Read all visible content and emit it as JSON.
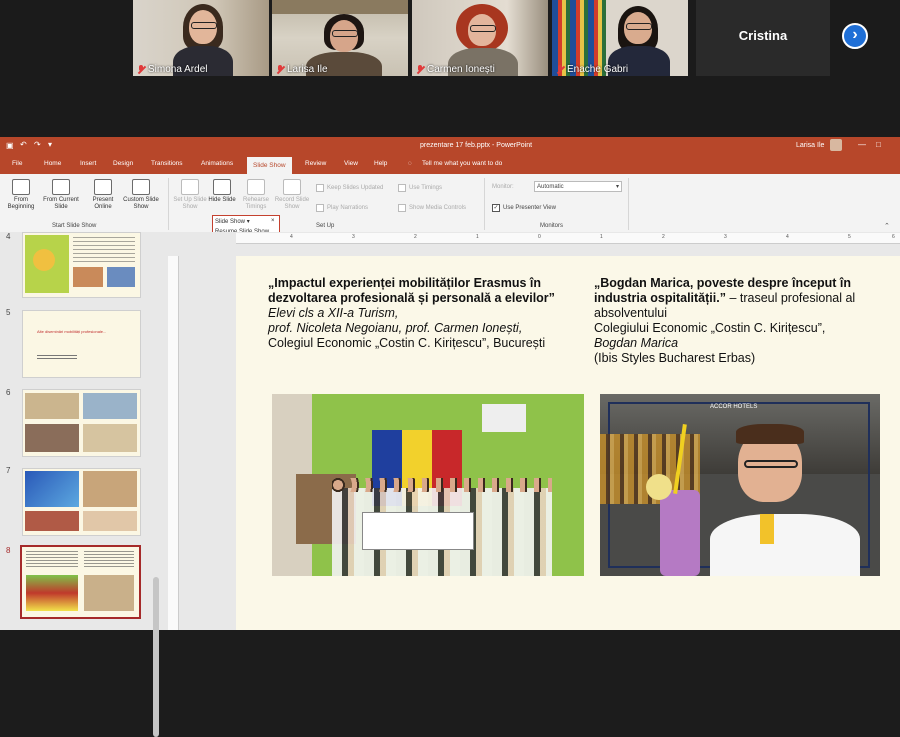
{
  "meeting": {
    "participants": [
      {
        "name": "Simona Ardel"
      },
      {
        "name": "Larisa Ile"
      },
      {
        "name": "Carmen Ionești"
      },
      {
        "name": "Enache Gabri"
      }
    ],
    "cristina_label": "Cristina",
    "next_icon": "chevron-right-icon"
  },
  "ppt": {
    "doc_title": "prezentare 17 feb.pptx - PowerPoint",
    "user": "Larisa Ile",
    "tabs": [
      "File",
      "Home",
      "Insert",
      "Design",
      "Transitions",
      "Animations",
      "Slide Show",
      "Review",
      "View",
      "Help"
    ],
    "active_tab": "Slide Show",
    "tell_me": "Tell me what you want to do",
    "ribbon": {
      "from_beginning": "From Beginning",
      "from_current": "From Current Slide",
      "present_online": "Present Online",
      "custom_show": "Custom Slide Show",
      "group_start": "Start Slide Show",
      "setup_show": "Set Up Slide Show",
      "hide_slide": "Hide Slide",
      "rehearse": "Rehearse Timings",
      "record": "Record Slide Show",
      "keep_updated": "Keep Slides Updated",
      "play_narrations": "Play Narrations",
      "use_timings": "Use Timings",
      "show_media": "Show Media Controls",
      "group_setup": "Set Up",
      "monitor_label": "Monitor:",
      "monitor_value": "Automatic",
      "presenter_view": "Use Presenter View",
      "group_monitors": "Monitors"
    },
    "dropdown": {
      "item1": "Slide Show",
      "item2": "Resume Slide Show"
    },
    "ruler": [
      "4",
      "3",
      "2",
      "1",
      "0",
      "1",
      "2",
      "3",
      "4",
      "5",
      "6"
    ],
    "thumb_numbers": [
      "4",
      "5",
      "6",
      "7",
      "8"
    ],
    "slide5_text": "Alte diseminări mobilități profesionale..."
  },
  "slide": {
    "left": {
      "title": "„Impactul experienței mobilităților Erasmus în dezvoltarea profesională și personală a elevilor”",
      "line1": "Elevi cls a XII-a Turism,",
      "line2": "prof. Nicoleta Negoianu, prof. Carmen Ionești,",
      "line3": "Colegiul Economic „Costin C. Kirițescu”, București"
    },
    "right": {
      "title": "„Bogdan Marica, poveste despre început în industria ospitalității.”",
      "title_tail": " – traseul profesional al absolventului",
      "line1": "Colegiului Economic „Costin C. Kirițescu”,",
      "line2": "Bogdan Marica",
      "line3": "(Ibis Styles Bucharest Erbas)"
    }
  }
}
